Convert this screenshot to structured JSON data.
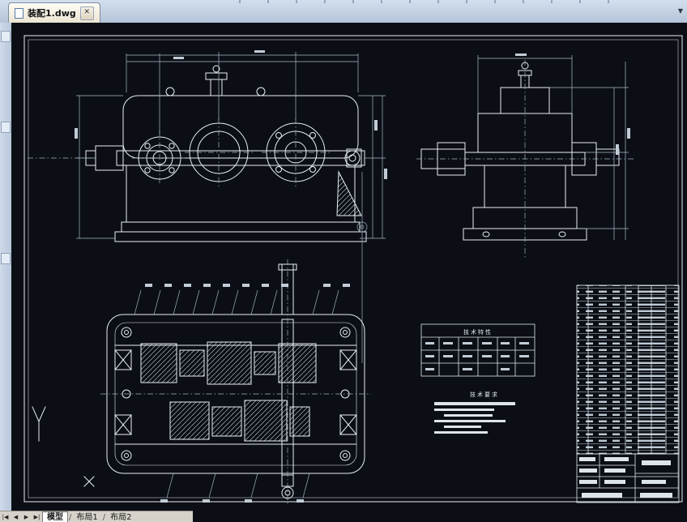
{
  "window": {
    "document_tab": {
      "label": "装配1.dwg",
      "close": "✕"
    },
    "tab_overflow": "▼"
  },
  "drawing": {
    "tables": {
      "tech_spec_title": "技术特性",
      "tech_req_title": "技术要求"
    },
    "colors": {
      "canvas_bg": "#0b0f15",
      "line": "#e8eef4",
      "tabbar_bg": "#b9c8dc",
      "active_tab_bg": "#f4efe2"
    }
  },
  "bottom_bar": {
    "nav_first": "|◀",
    "nav_prev": "◀",
    "nav_next": "▶",
    "nav_last": "▶|",
    "tabs": [
      {
        "label": "模型"
      },
      {
        "label": "布局1"
      },
      {
        "label": "布局2"
      }
    ],
    "separator": "/"
  }
}
